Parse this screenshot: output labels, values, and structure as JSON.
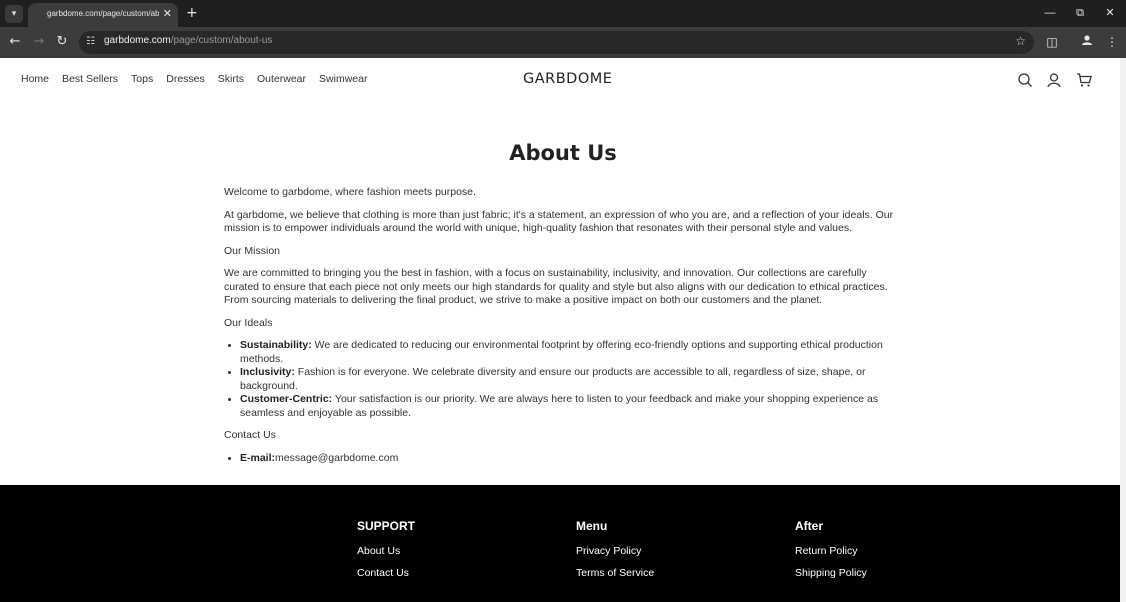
{
  "browser": {
    "tab_title": "garbdome.com/page/custom/about-us",
    "new_tab_symbol": "+",
    "url_host": "garbdome.com",
    "url_path": "/page/custom/about-us"
  },
  "site": {
    "logo": "GARBDOME",
    "nav": [
      "Home",
      "Best Sellers",
      "Tops",
      "Dresses",
      "Skirts",
      "Outerwear",
      "Swimwear"
    ]
  },
  "page": {
    "title": "About Us",
    "intro": "Welcome to garbdome, where fashion meets purpose.",
    "paragraph1": "At garbdome, we believe that clothing is more than just fabric; it's a statement, an expression of who you are, and a reflection of your ideals. Our mission is to empower individuals around the world with unique, high-quality fashion that resonates with their personal style and values.",
    "mission_heading": "Our Mission",
    "mission_text": "We are committed to bringing you the best in fashion, with a focus on sustainability, inclusivity, and innovation. Our collections are carefully curated to ensure that each piece not only meets our high standards for quality and style but also aligns with our dedication to ethical practices. From sourcing materials to delivering the final product, we strive to make a positive impact on both our customers and the planet.",
    "ideals_heading": "Our Ideals",
    "ideals": [
      {
        "term": "Sustainability:",
        "text": " We are dedicated to reducing our environmental footprint by offering eco-friendly options and supporting ethical production methods."
      },
      {
        "term": "Inclusivity:",
        "text": " Fashion is for everyone. We celebrate diversity and ensure our products are accessible to all, regardless of size, shape, or background."
      },
      {
        "term": "Customer-Centric:",
        "text": " Your satisfaction is our priority. We are always here to listen to your feedback and make your shopping experience as seamless and enjoyable as possible."
      }
    ],
    "contact_heading": "Contact Us",
    "email_label": "E-mail:",
    "email": "message@garbdome.com"
  },
  "footer": {
    "columns": [
      {
        "heading": "SUPPORT",
        "links": [
          "About Us",
          "Contact Us"
        ]
      },
      {
        "heading": "Menu",
        "links": [
          "Privacy Policy",
          "Terms of Service"
        ]
      },
      {
        "heading": "After",
        "links": [
          "Return Policy",
          "Shipping Policy"
        ]
      }
    ]
  }
}
